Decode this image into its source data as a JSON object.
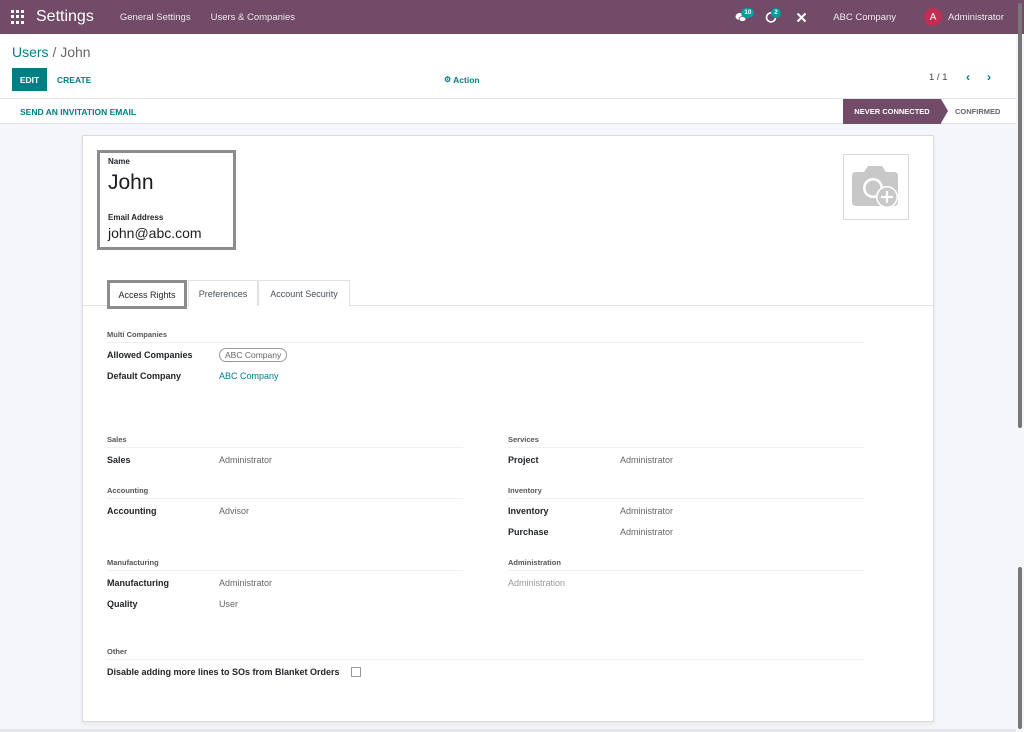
{
  "navbar": {
    "app_title": "Settings",
    "menus": [
      "General Settings",
      "Users & Companies"
    ],
    "messages_badge": "10",
    "activities_badge": "2",
    "company": "ABC Company",
    "user_initial": "A",
    "user_name": "Administrator"
  },
  "breadcrumb": {
    "parent": "Users",
    "separator": "/",
    "current": "John"
  },
  "control_panel": {
    "edit_label": "EDIT",
    "create_label": "CREATE",
    "action_label": "Action",
    "pager_value": "1 / 1"
  },
  "statusbar": {
    "invite_label": "SEND AN INVITATION EMAIL",
    "stages": [
      {
        "label": "NEVER CONNECTED",
        "active": true
      },
      {
        "label": "CONFIRMED",
        "active": false
      }
    ]
  },
  "form": {
    "name_label": "Name",
    "name_value": "John",
    "email_label": "Email Address",
    "email_value": "john@abc.com",
    "tabs": [
      "Access Rights",
      "Preferences",
      "Account Security"
    ],
    "active_tab": "Access Rights",
    "multi_companies": {
      "title": "Multi Companies",
      "allowed_label": "Allowed Companies",
      "allowed_tags": [
        "ABC Company"
      ],
      "default_label": "Default Company",
      "default_value": "ABC Company"
    },
    "sections": {
      "sales": {
        "title": "Sales",
        "rows": [
          {
            "label": "Sales",
            "value": "Administrator"
          }
        ]
      },
      "services": {
        "title": "Services",
        "rows": [
          {
            "label": "Project",
            "value": "Administrator"
          }
        ]
      },
      "accounting": {
        "title": "Accounting",
        "rows": [
          {
            "label": "Accounting",
            "value": "Advisor"
          }
        ]
      },
      "inventory": {
        "title": "Inventory",
        "rows": [
          {
            "label": "Inventory",
            "value": "Administrator"
          },
          {
            "label": "Purchase",
            "value": "Administrator"
          }
        ]
      },
      "manufacturing": {
        "title": "Manufacturing",
        "rows": [
          {
            "label": "Manufacturing",
            "value": "Administrator"
          },
          {
            "label": "Quality",
            "value": "User"
          }
        ]
      },
      "administration": {
        "title": "Administration",
        "rows": [
          {
            "label": "",
            "value": "Administration"
          }
        ]
      },
      "other": {
        "title": "Other",
        "rows": [
          {
            "label": "Disable adding more lines to SOs from Blanket Orders",
            "checked": false
          }
        ]
      }
    }
  },
  "colors": {
    "brand": "#714b67",
    "accent": "#017e84",
    "badge": "#00a09d",
    "avatar": "#c22e51"
  }
}
